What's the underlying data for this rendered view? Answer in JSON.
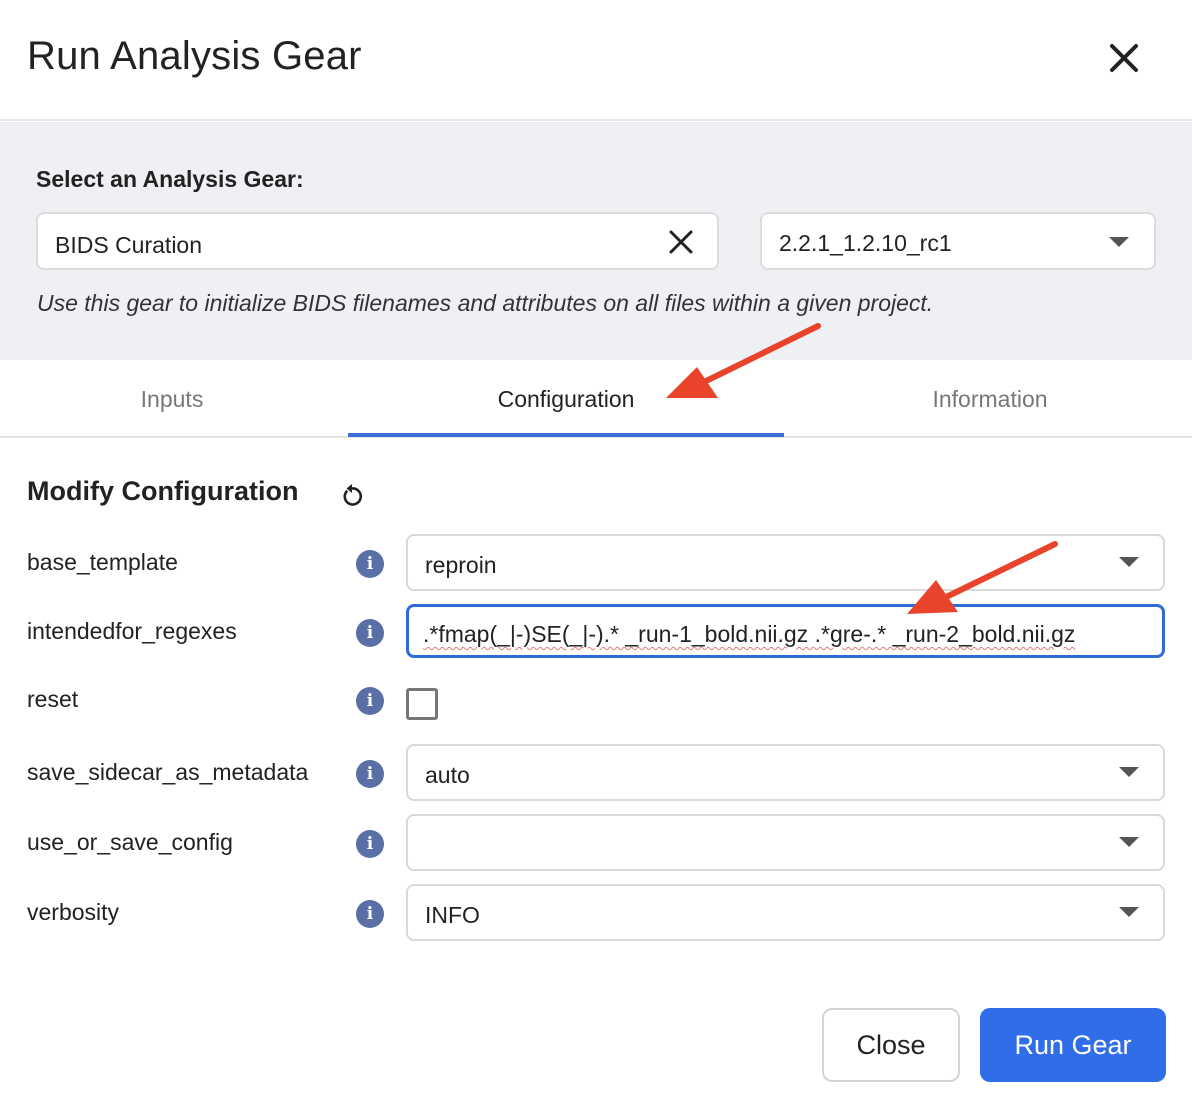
{
  "dialog": {
    "title": "Run Analysis Gear"
  },
  "gear_select": {
    "label": "Select an Analysis Gear:",
    "value": "BIDS Curation",
    "version": "2.2.1_1.2.10_rc1",
    "description": "Use this gear to initialize BIDS filenames and attributes on all files within a given project."
  },
  "tabs": [
    {
      "label": "Inputs",
      "active": false
    },
    {
      "label": "Configuration",
      "active": true
    },
    {
      "label": "Information",
      "active": false
    }
  ],
  "config": {
    "title": "Modify Configuration",
    "rows": [
      {
        "label": "base_template",
        "type": "select",
        "value": "reproin"
      },
      {
        "label": "intendedfor_regexes",
        "type": "text",
        "value": ".*fmap(_|-)SE(_|-).* _run-1_bold.nii.gz .*gre-.* _run-2_bold.nii.gz"
      },
      {
        "label": "reset",
        "type": "checkbox",
        "checked": false
      },
      {
        "label": "save_sidecar_as_metadata",
        "type": "select",
        "value": "auto"
      },
      {
        "label": "use_or_save_config",
        "type": "select",
        "value": ""
      },
      {
        "label": "verbosity",
        "type": "select",
        "value": "INFO"
      }
    ]
  },
  "buttons": {
    "close": "Close",
    "run": "Run Gear"
  },
  "icons": {
    "close": "close-icon",
    "clear": "clear-icon",
    "dropdown": "chevron-down-icon",
    "reset": "reset-icon",
    "info": "info-icon"
  },
  "colors": {
    "accent": "#2f6ee8",
    "panel_bg": "#eef0f3",
    "annotation_arrow": "#e8442c",
    "info_icon": "#5a6fa6"
  }
}
